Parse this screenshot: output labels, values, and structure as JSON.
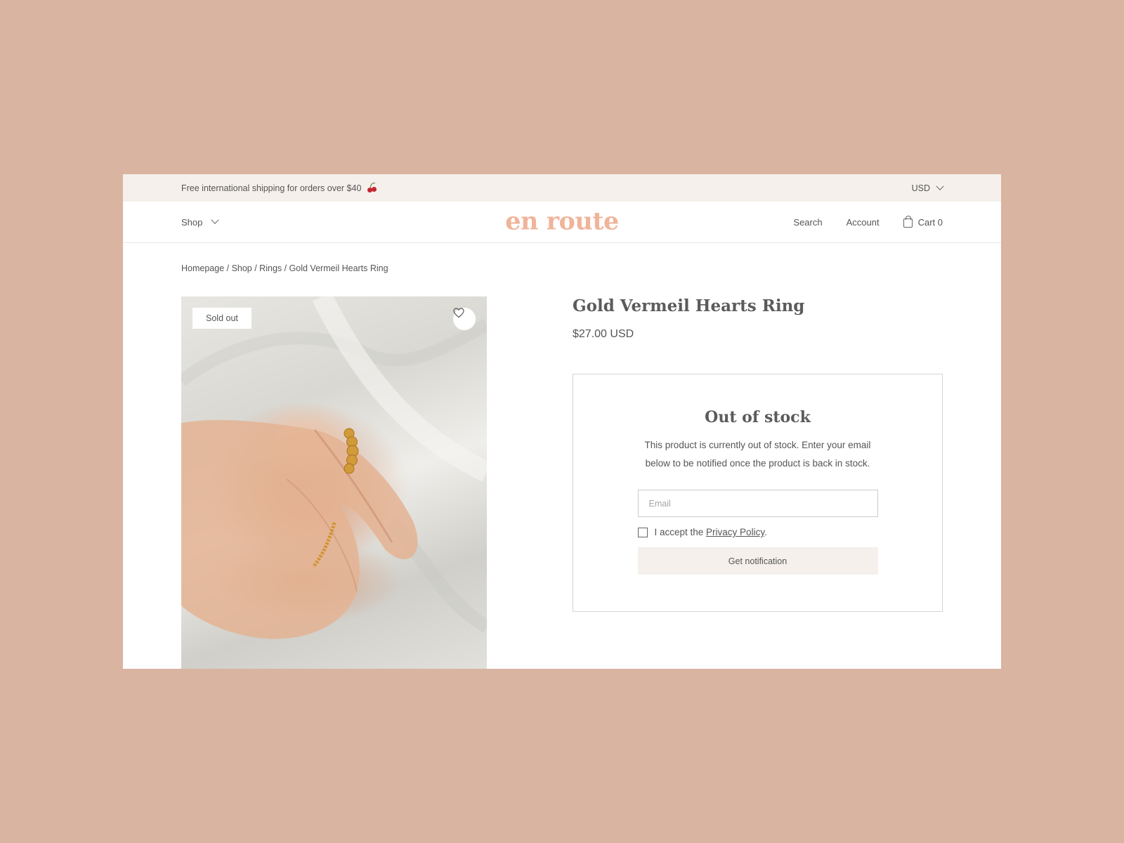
{
  "announcement": {
    "text": "Free international shipping for orders over $40",
    "icon": "cherry-icon"
  },
  "currency": {
    "selected": "USD"
  },
  "header": {
    "shop_label": "Shop",
    "logo_text": "en route",
    "search_label": "Search",
    "account_label": "Account",
    "cart_label": "Cart 0"
  },
  "breadcrumb": {
    "text": "Homepage / Shop / Rings / Gold Vermeil Hearts Ring",
    "items": [
      "Homepage",
      "Shop",
      "Rings",
      "Gold Vermeil Hearts Ring"
    ]
  },
  "product": {
    "badge": "Sold out",
    "title": "Gold Vermeil Hearts Ring",
    "price": "$27.00 USD",
    "wishlist_icon": "heart-icon"
  },
  "out_of_stock": {
    "title": "Out of stock",
    "message": "This product is currently out of stock. Enter your email below to be notified once the product is back in stock.",
    "email_placeholder": "Email",
    "email_value": "",
    "consent_prefix": "I accept the ",
    "consent_link": "Privacy Policy",
    "consent_suffix": ".",
    "button_label": "Get notification"
  },
  "colors": {
    "background": "#d9b4a1",
    "announcement_bg": "#f5f0eb",
    "logo": "#f0b49a",
    "text": "#555555"
  }
}
